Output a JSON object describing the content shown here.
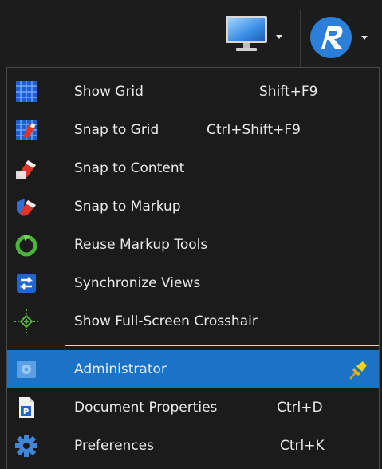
{
  "toolbar": {
    "display_icon": "monitor-icon",
    "app_icon": "revu-logo-icon"
  },
  "menu": {
    "items": [
      {
        "label": "Show Grid",
        "shortcut": "Shift+F9",
        "icon": "grid-icon"
      },
      {
        "label": "Snap to Grid",
        "shortcut": "Ctrl+Shift+F9",
        "icon": "snap-grid-magnet-icon"
      },
      {
        "label": "Snap to Content",
        "shortcut": "",
        "icon": "snap-content-magnet-icon"
      },
      {
        "label": "Snap to Markup",
        "shortcut": "",
        "icon": "snap-markup-magnet-icon"
      },
      {
        "label": "Reuse Markup Tools",
        "shortcut": "",
        "icon": "reuse-circle-icon"
      },
      {
        "label": "Synchronize Views",
        "shortcut": "",
        "icon": "sync-arrows-icon"
      },
      {
        "label": "Show Full-Screen Crosshair",
        "shortcut": "",
        "icon": "crosshair-icon"
      },
      {
        "label": "Administrator",
        "shortcut": "",
        "icon": "admin-gear-icon",
        "pin_icon": "pin-icon"
      },
      {
        "label": "Document Properties",
        "shortcut": "Ctrl+D",
        "icon": "document-properties-icon"
      },
      {
        "label": "Preferences",
        "shortcut": "Ctrl+K",
        "icon": "preferences-gear-icon"
      }
    ],
    "highlighted_color": "#1a73c7"
  }
}
